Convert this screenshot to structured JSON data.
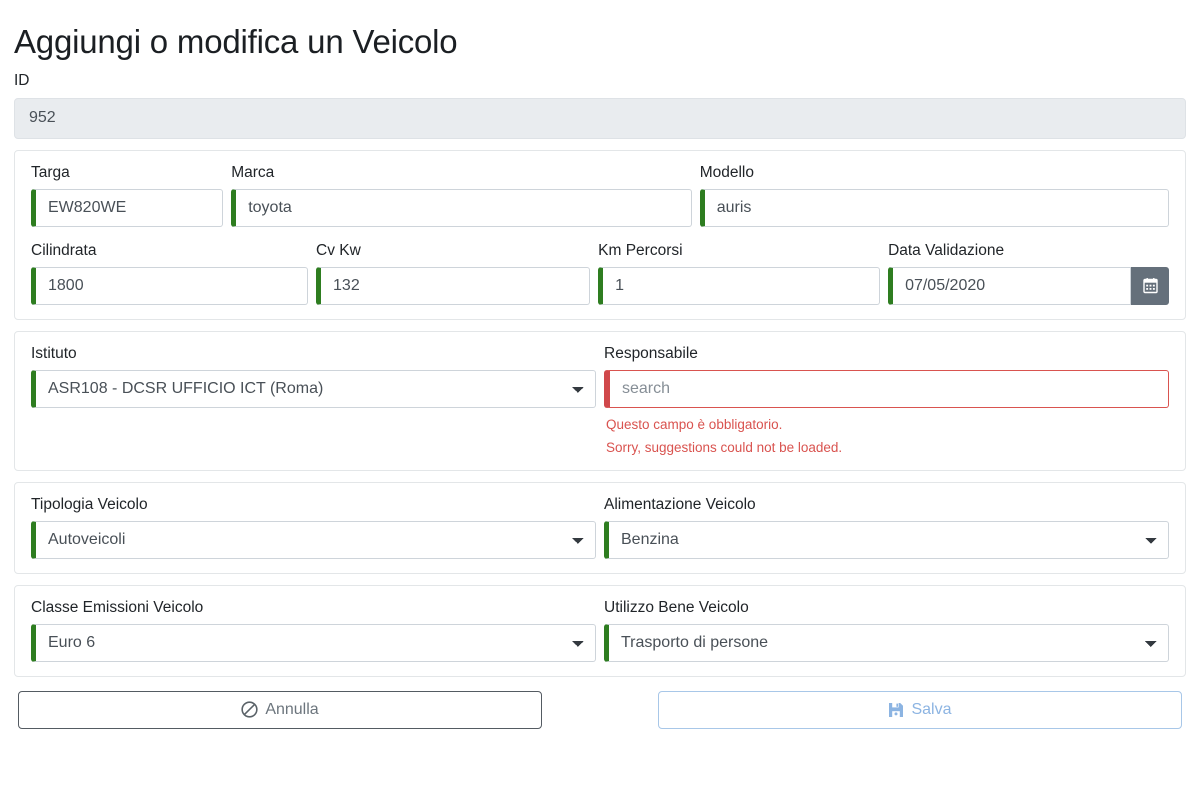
{
  "page": {
    "title": "Aggiungi o modifica un Veicolo"
  },
  "id_field": {
    "label": "ID",
    "value": "952",
    "name": "id-input"
  },
  "section_anagrafica": {
    "targa": {
      "label": "Targa",
      "value": "EW820WE",
      "state": "valid"
    },
    "marca": {
      "label": "Marca",
      "value": "toyota",
      "state": "valid"
    },
    "modello": {
      "label": "Modello",
      "value": "auris",
      "state": "valid"
    }
  },
  "section_tecnica": {
    "cilindrata": {
      "label": "Cilindrata",
      "value": "1800",
      "state": "valid"
    },
    "cv_kw": {
      "label": "Cv Kw",
      "value": "132",
      "state": "valid"
    },
    "km_percorsi": {
      "label": "Km Percorsi",
      "value": "1",
      "state": "valid"
    },
    "data_validazione": {
      "label": "Data Validazione",
      "value": "07/05/2020",
      "state": "valid"
    },
    "calendar_button": {
      "icon": "calendar-icon"
    }
  },
  "section_assegnazione": {
    "istituto": {
      "label": "Istituto",
      "value": "ASR108 - DCSR UFFICIO ICT (Roma)",
      "state": "valid",
      "options": [
        "ASR108 - DCSR UFFICIO ICT (Roma)"
      ]
    },
    "responsabile": {
      "label": "Responsabile",
      "value": "",
      "placeholder": "search",
      "state": "invalid",
      "errors": [
        "Questo campo è obbligatorio.",
        "Sorry, suggestions could not be loaded."
      ]
    }
  },
  "section_classificazione": {
    "tipologia": {
      "label": "Tipologia Veicolo",
      "value": "Autoveicoli",
      "state": "valid",
      "options": [
        "Autoveicoli"
      ]
    },
    "alimentazione": {
      "label": "Alimentazione Veicolo",
      "value": "Benzina",
      "state": "valid",
      "options": [
        "Benzina"
      ]
    }
  },
  "section_emissioni": {
    "classe_emissioni": {
      "label": "Classe Emissioni Veicolo",
      "value": "Euro 6",
      "state": "valid",
      "options": [
        "Euro 6"
      ]
    },
    "utilizzo_bene": {
      "label": "Utilizzo Bene Veicolo",
      "value": "Trasporto di persone",
      "state": "valid",
      "options": [
        "Trasporto di persone"
      ]
    }
  },
  "footer": {
    "cancel": {
      "label": "Annulla",
      "icon": "ban-icon"
    },
    "save": {
      "label": "Salva",
      "icon": "save-icon",
      "disabled": true
    }
  },
  "colors": {
    "valid_bar": "#2e7d20",
    "invalid_bar": "#d0484b",
    "error_text": "#d9534f",
    "calendar_button_bg": "#65707b",
    "readonly_bg": "#e9ecef",
    "save_disabled": "#8cb4e2",
    "cancel_border": "#545b62"
  }
}
